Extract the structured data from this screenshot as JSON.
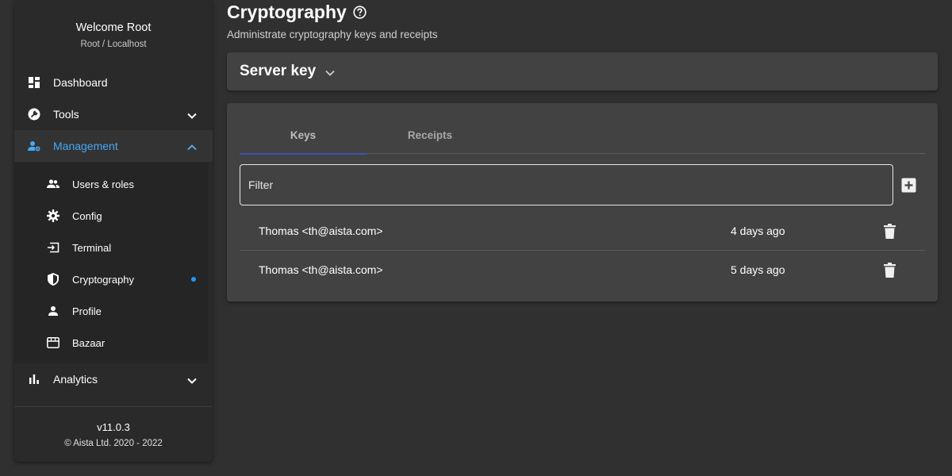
{
  "sidebar": {
    "welcome_title": "Welcome Root",
    "welcome_subtitle": "Root / Localhost",
    "items": [
      {
        "label": "Dashboard",
        "icon": "dashboard-icon"
      },
      {
        "label": "Tools",
        "icon": "wrench-icon",
        "expanded": false
      },
      {
        "label": "Management",
        "icon": "manage-accounts-icon",
        "expanded": true,
        "active": true
      },
      {
        "label": "Analytics",
        "icon": "bar-chart-icon",
        "expanded": false
      }
    ],
    "submenu": [
      {
        "label": "Users & roles",
        "icon": "people-icon"
      },
      {
        "label": "Config",
        "icon": "gear-icon"
      },
      {
        "label": "Terminal",
        "icon": "terminal-icon"
      },
      {
        "label": "Cryptography",
        "icon": "shield-icon",
        "active": true
      },
      {
        "label": "Profile",
        "icon": "person-icon"
      },
      {
        "label": "Bazaar",
        "icon": "store-icon"
      }
    ],
    "version": "v11.0.3",
    "copyright": "© Aista Ltd. 2020 - 2022"
  },
  "header": {
    "title": "Cryptography",
    "subtitle": "Administrate cryptography keys and receipts"
  },
  "server_key": {
    "label": "Server key"
  },
  "tabs": [
    {
      "label": "Keys",
      "active": true
    },
    {
      "label": "Receipts",
      "active": false
    }
  ],
  "filter": {
    "placeholder": "Filter",
    "value": ""
  },
  "keys": [
    {
      "name": "Thomas <th@aista.com>",
      "time": "4 days ago"
    },
    {
      "name": "Thomas <th@aista.com>",
      "time": "5 days ago"
    }
  ],
  "colors": {
    "accent": "#46a8f5",
    "tab_indicator": "#3f51b5",
    "background": "#303030",
    "card": "#424242"
  }
}
